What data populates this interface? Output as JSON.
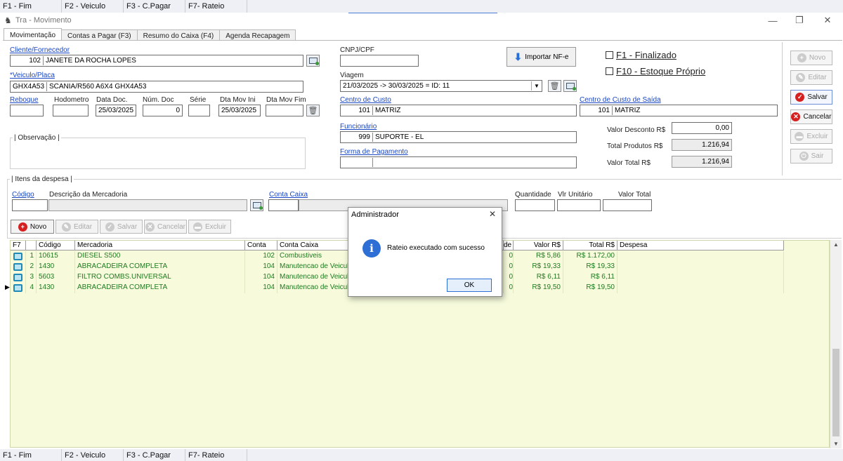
{
  "hotkeys": [
    "F1 - Fim",
    "F2 - Veiculo",
    "F3 - C.Pagar",
    "F7- Rateio"
  ],
  "window": {
    "title": "Tra - Movimento",
    "minimize": "—",
    "restore": "❐",
    "close": "✕"
  },
  "tabs": [
    "Movimentação",
    "Contas a Pagar (F3)",
    "Resumo do Caixa (F4)",
    "Agenda Recapagem"
  ],
  "form": {
    "cliente_label": "Cliente/Fornecedor",
    "cliente_code": "102",
    "cliente_name": "JANETE DA ROCHA LOPES",
    "cnpj_label": "CNPJ/CPF",
    "cnpj_value": "",
    "importar_label": "Importar NF-e",
    "finalizado_label": "F1 - Finalizado",
    "estoque_label": "F10 - Estoque Próprio",
    "veiculo_label": "*Veiculo/Placa",
    "veiculo_placa": "GHX4A53",
    "veiculo_desc": "SCANIA/R560 A6X4 GHX4A53",
    "viagem_label": "Viagem",
    "viagem_value": "21/03/2025 -> 30/03/2025 = ID: 11",
    "reboque_label": "Reboque",
    "hodometro_label": "Hodometro",
    "datadoc_label": "Data Doc.",
    "datadoc_value": "25/03/2025",
    "numdoc_label": "Núm. Doc",
    "numdoc_value": "0",
    "serie_label": "Série",
    "dtaini_label": "Dta Mov Ini",
    "dtaini_value": "25/03/2025",
    "dtafim_label": "Dta Mov Fim",
    "cc_label": "Centro de Custo",
    "cc_code": "101",
    "cc_name": "MATRIZ",
    "ccs_label": "Centro de Custo de Saída",
    "ccs_code": "101",
    "ccs_name": "MATRIZ",
    "obs_label": "| Observação |",
    "func_label": "Funcionário",
    "func_code": "999",
    "func_name": "SUPORTE - EL",
    "forma_label": "Forma de Pagamento",
    "desc_label": "Valor Desconto R$",
    "desc_value": "0,00",
    "totprod_label": "Total Produtos R$",
    "totprod_value": "1.216,94",
    "total_label": "Valor Total R$",
    "total_value": "1.216,94"
  },
  "side_buttons": {
    "novo": "Novo",
    "editar": "Editar",
    "salvar": "Salvar",
    "cancelar": "Cancelar",
    "excluir": "Excluir",
    "sair": "Sair"
  },
  "itens": {
    "group_label": "| Itens da despesa |",
    "codigo_label": "Código",
    "descricao_label": "Descrição da Mercadoria",
    "conta_label": "Conta Caixa",
    "qtd_label": "Quantidade",
    "vlr_label": "Vlr Unitário",
    "vtotal_label": "Valor Total",
    "buttons": {
      "novo": "Novo",
      "editar": "Editar",
      "salvar": "Salvar",
      "cancelar": "Cancelar",
      "excluir": "Excluir"
    }
  },
  "grid": {
    "headers": [
      "F7",
      "Código",
      "Mercadoria",
      "Conta",
      "Conta Caixa",
      "de",
      "Valor R$",
      "Total R$",
      "Despesa"
    ],
    "rows": [
      {
        "n": "1",
        "codigo": "10615",
        "merc": "DIESEL S500",
        "conta": "102",
        "caixa": "Combustiveis",
        "de": "0",
        "valor": "R$ 5,86",
        "total": "R$ 1.172,00"
      },
      {
        "n": "2",
        "codigo": "1430",
        "merc": "ABRACADEIRA COMPLETA",
        "conta": "104",
        "caixa": "Manutencao de Veiculo",
        "de": "0",
        "valor": "R$ 19,33",
        "total": "R$ 19,33"
      },
      {
        "n": "3",
        "codigo": "5603",
        "merc": "FILTRO COMBS.UNIVERSAL",
        "conta": "104",
        "caixa": "Manutencao de Veiculo",
        "de": "0",
        "valor": "R$ 6,11",
        "total": "R$ 6,11"
      },
      {
        "n": "4",
        "codigo": "1430",
        "merc": "ABRACADEIRA COMPLETA",
        "conta": "104",
        "caixa": "Manutencao de Veiculo",
        "de": "0",
        "valor": "R$ 19,50",
        "total": "R$ 19,50"
      }
    ]
  },
  "dialog": {
    "title": "Administrador",
    "message": "Rateio executado com sucesso",
    "ok": "OK",
    "close": "✕"
  }
}
